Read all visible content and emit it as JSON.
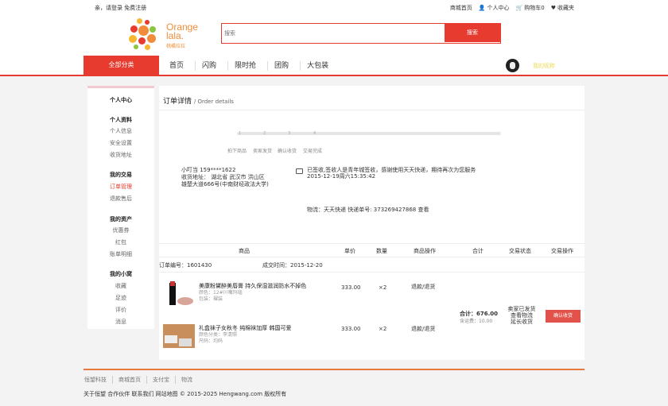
{
  "topbar": {
    "greeting": "亲，请登录 免费注册",
    "links": [
      "商城首页",
      "个人中心",
      "购物车0",
      "收藏夹"
    ]
  },
  "header": {
    "logo_text_1": "Orange",
    "logo_text_2": "lala.",
    "logo_sub": "桃橘拉拉",
    "search_placeholder": "搜索",
    "search_button": "搜索"
  },
  "nav": {
    "all_categories": "全部分类",
    "items": [
      "首页",
      "闪购",
      "限时抢",
      "团购",
      "大包装"
    ],
    "user_name": "我的昵称"
  },
  "sidebar": {
    "center": "个人中心",
    "groups": [
      {
        "title": "个人资料",
        "items": [
          "个人信息",
          "安全设置",
          "收货地址"
        ]
      },
      {
        "title": "我的交易",
        "items": [
          "订单管理",
          "退款售后"
        ]
      },
      {
        "title": "我的资产",
        "items": [
          "优惠券",
          "红包",
          "账单明细"
        ]
      },
      {
        "title": "我的小窝",
        "items": [
          "收藏",
          "足迹",
          "评价",
          "消息"
        ]
      }
    ]
  },
  "order": {
    "title": "订单详情",
    "title_en": "/ Order details",
    "steps_numbers": [
      "1",
      "2",
      "3",
      "4"
    ],
    "steps": [
      "拍下商品",
      "卖家发货",
      "确认收货",
      "交易完成"
    ],
    "address_name": "小叮当 159****1622",
    "address_detail": "收货地址： 湖北省 武汉市 洪山区 雄楚大道666号(中南财经政法大学)",
    "notice": "已签收,签收人是青年城签收，感谢使用天天快递，期待再次为您服务",
    "notice_time": "2015-12-19周六15:35:42",
    "logistics": "物流：天天快递 快递单号: 373269427868 查看",
    "headers": [
      "商品",
      "单价",
      "数量",
      "商品操作",
      "合计",
      "交易状态",
      "交易操作"
    ],
    "order_no": "订单编号：1601430",
    "order_time": "成交时间：2015-12-20",
    "items": [
      {
        "name": "美康粉黛醉美唇膏 持久保湿滋润防水不掉色",
        "attr1": "颜色：12#川嘴玛瑙",
        "attr2": "包装：裸装",
        "price": "333.00",
        "qty": "×2",
        "op": "退款/退货"
      },
      {
        "name": "礼盒袜子女秋冬 纯棉袜加厚 韩国可爱",
        "attr1": "颜色分类：李清照",
        "attr2": "尺码：均码",
        "price": "333.00",
        "qty": "×2",
        "op": "退款/退货"
      }
    ],
    "total": "合计：676.00",
    "shipping": "含运费：10.00",
    "status": [
      "卖家已发货",
      "查看物流",
      "延长收货"
    ],
    "confirm_button": "确认收货"
  },
  "footer": {
    "links": [
      "恒望科技",
      "商城首页",
      "支付宝",
      "物流"
    ],
    "copyright": "关于恒望 合作伙伴 联系我们 网站地图 © 2015-2025 Hengwang.com 版权所有"
  },
  "colors": {
    "accent": "#e63b2e",
    "logo": "#f08c3a"
  }
}
